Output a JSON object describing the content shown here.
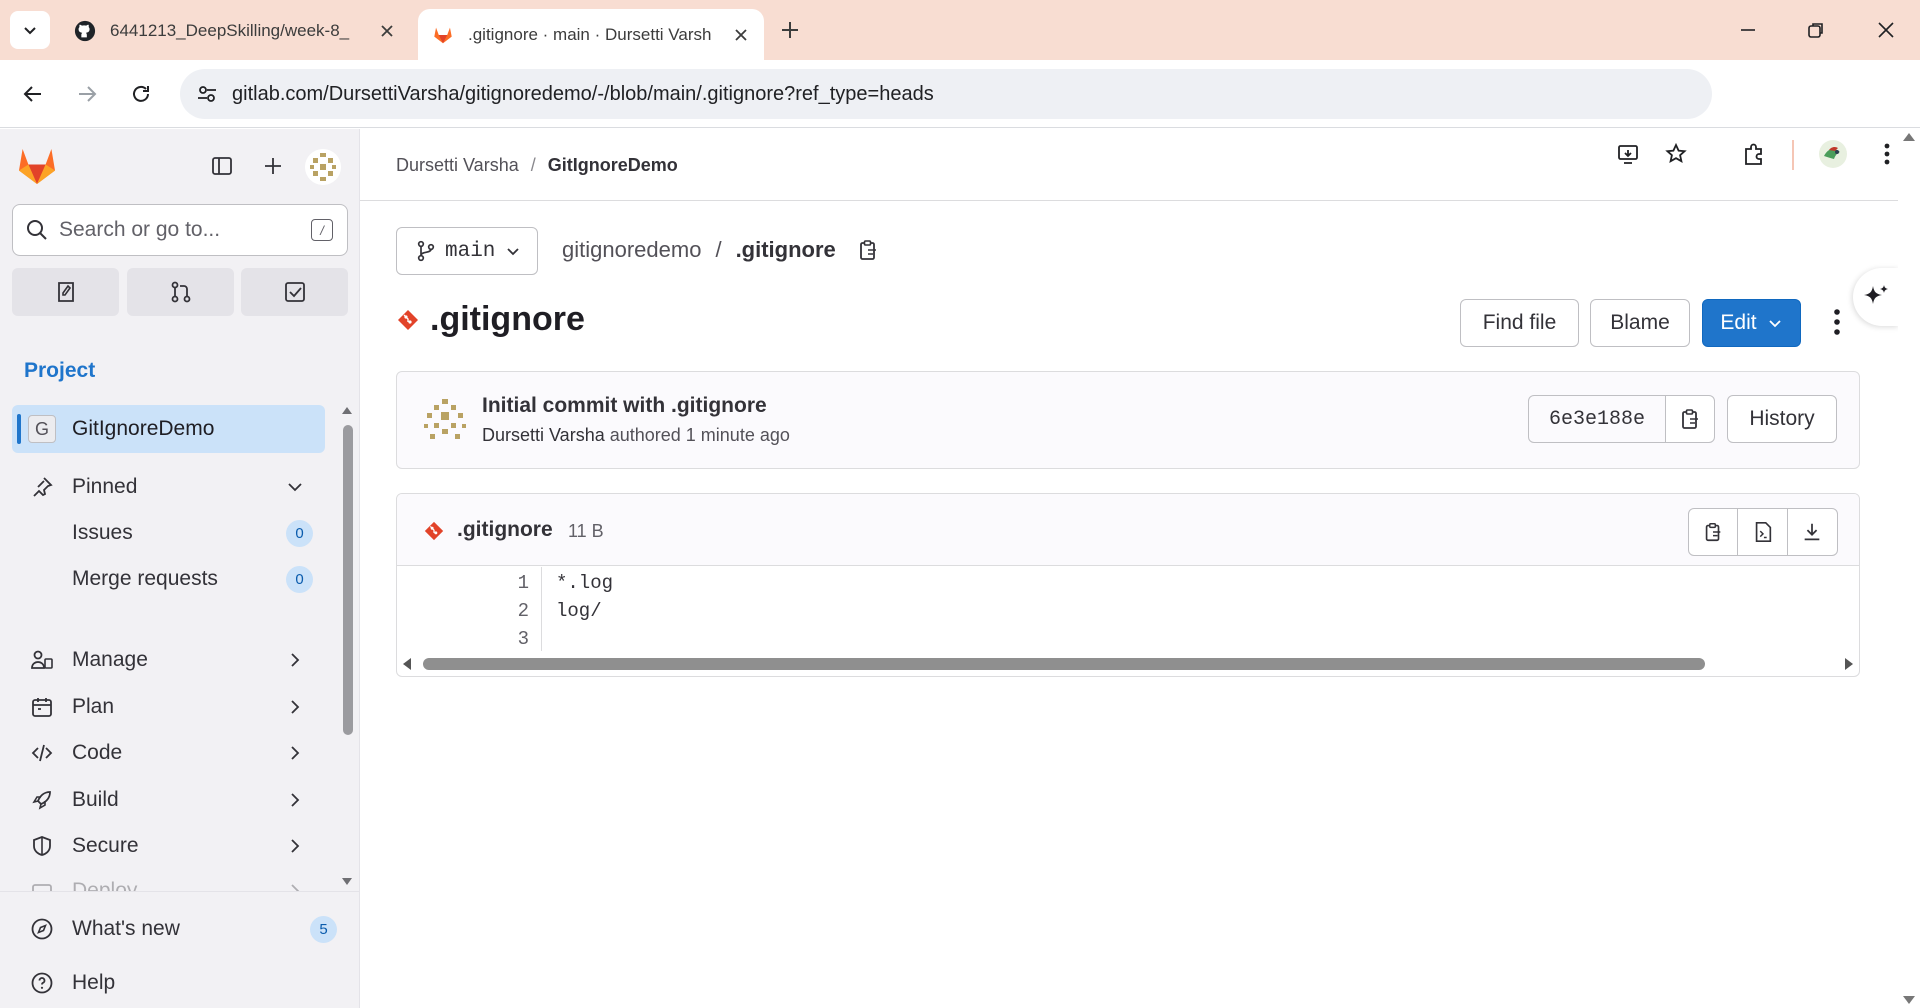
{
  "browser": {
    "tabs": [
      {
        "title": "6441213_DeepSkilling/week-8_",
        "favicon": "github-icon",
        "active": false
      },
      {
        "title": ".gitignore · main · Dursetti Varsh",
        "favicon": "gitlab-icon",
        "active": true
      }
    ],
    "url": "gitlab.com/DursettiVarsha/gitignoredemo/-/blob/main/.gitignore?ref_type=heads"
  },
  "sidebar": {
    "search_placeholder": "Search or go to...",
    "search_shortcut": "/",
    "section_title": "Project",
    "project": {
      "initial": "G",
      "name": "GitIgnoreDemo"
    },
    "pinned": {
      "label": "Pinned",
      "items": [
        {
          "label": "Issues",
          "count": "0"
        },
        {
          "label": "Merge requests",
          "count": "0"
        }
      ]
    },
    "menu": [
      {
        "label": "Manage",
        "icon": "users-icon"
      },
      {
        "label": "Plan",
        "icon": "calendar-icon"
      },
      {
        "label": "Code",
        "icon": "code-icon"
      },
      {
        "label": "Build",
        "icon": "rocket-icon"
      },
      {
        "label": "Secure",
        "icon": "shield-icon"
      },
      {
        "label": "Deploy",
        "icon": "deploy-icon"
      }
    ],
    "whats_new": {
      "label": "What's new",
      "count": "5"
    },
    "help": {
      "label": "Help"
    }
  },
  "breadcrumb": {
    "owner": "Dursetti Varsha",
    "project": "GitIgnoreDemo"
  },
  "repo": {
    "branch": "main",
    "project_path": "gitignoredemo",
    "file_path": ".gitignore"
  },
  "file": {
    "title": ".gitignore",
    "size": "11 B",
    "lines": [
      "*.log",
      "log/",
      ""
    ]
  },
  "actions": {
    "find_file": "Find file",
    "blame": "Blame",
    "edit": "Edit",
    "history": "History"
  },
  "commit": {
    "message": "Initial commit with .gitignore",
    "author": "Dursetti Varsha",
    "authored_text": "authored 1 minute ago",
    "sha": "6e3e188e"
  },
  "colors": {
    "accent": "#1f75cb",
    "gitlab_orange": "#fc6d26",
    "git_icon": "#e24329",
    "tabstrip": "#f8ddd2"
  }
}
